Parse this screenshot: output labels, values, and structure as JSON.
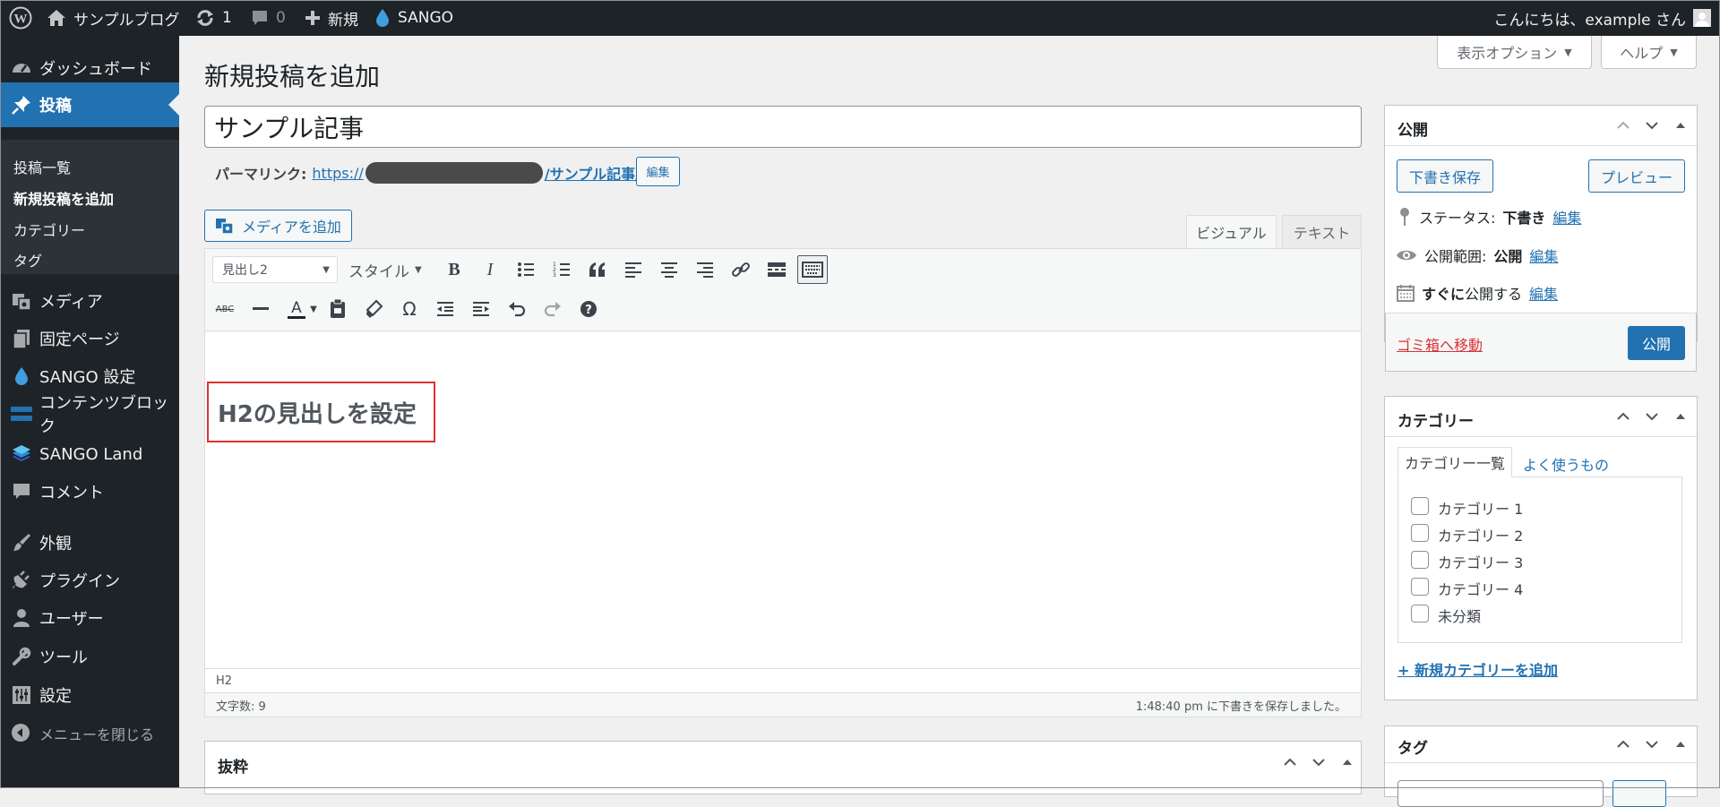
{
  "admin_bar": {
    "site_name": "サンプルブログ",
    "updates_count": "1",
    "comments_count": "0",
    "new_label": "新規",
    "sango_label": "SANGO",
    "greeting": "こんにちは、example さん"
  },
  "sidebar": {
    "items": [
      {
        "label": "ダッシュボード",
        "icon": "dashboard-icon"
      },
      {
        "label": "投稿",
        "icon": "pin-icon"
      },
      {
        "label": "メディア",
        "icon": "media-icon"
      },
      {
        "label": "固定ページ",
        "icon": "pages-icon"
      },
      {
        "label": "SANGO 設定",
        "icon": "drop-icon"
      },
      {
        "label": "コンテンツブロック",
        "icon": "blocks-icon"
      },
      {
        "label": "SANGO Land",
        "icon": "layers-icon"
      },
      {
        "label": "コメント",
        "icon": "comment-icon"
      },
      {
        "label": "外観",
        "icon": "brush-icon"
      },
      {
        "label": "プラグイン",
        "icon": "plugin-icon"
      },
      {
        "label": "ユーザー",
        "icon": "user-icon"
      },
      {
        "label": "ツール",
        "icon": "wrench-icon"
      },
      {
        "label": "設定",
        "icon": "settings-icon"
      },
      {
        "label": "メニューを閉じる",
        "icon": "collapse-icon"
      }
    ],
    "submenu": [
      "投稿一覧",
      "新規投稿を追加",
      "カテゴリー",
      "タグ"
    ]
  },
  "header": {
    "screen_options": "表示オプション",
    "help": "ヘルプ",
    "page_title": "新規投稿を追加"
  },
  "editor": {
    "title_value": "サンプル記事",
    "permalink_label": "パーマリンク:",
    "permalink_prefix": "https://",
    "permalink_slug": "/サンプル記事/",
    "edit_button": "編集",
    "add_media": "メディアを追加",
    "tab_visual": "ビジュアル",
    "tab_text": "テキスト",
    "format_select": "見出し2",
    "style_select": "スタイル",
    "content_heading": "H2の見出しを設定",
    "path": "H2",
    "word_count": "文字数: 9",
    "autosave_status": "1:48:40 pm に下書きを保存しました。"
  },
  "excerpt": {
    "title": "抜粋"
  },
  "publish": {
    "title": "公開",
    "save_draft": "下書き保存",
    "preview": "プレビュー",
    "status_label": "ステータス:",
    "status_value": "下書き",
    "visibility_label": "公開範囲:",
    "visibility_value": "公開",
    "schedule_bold": "すぐに",
    "schedule_label": "公開する",
    "edit_link": "編集",
    "trash": "ゴミ箱へ移動",
    "publish_button": "公開"
  },
  "categories": {
    "title": "カテゴリー",
    "tab_all": "カテゴリー一覧",
    "tab_popular": "よく使うもの",
    "items": [
      "カテゴリー 1",
      "カテゴリー 2",
      "カテゴリー 3",
      "カテゴリー 4",
      "未分類"
    ],
    "add_new": "+ 新規カテゴリーを追加"
  },
  "tags": {
    "title": "タグ"
  },
  "colors": {
    "admin_dark": "#1d2327",
    "accent": "#2271b1",
    "danger": "#d63638"
  }
}
